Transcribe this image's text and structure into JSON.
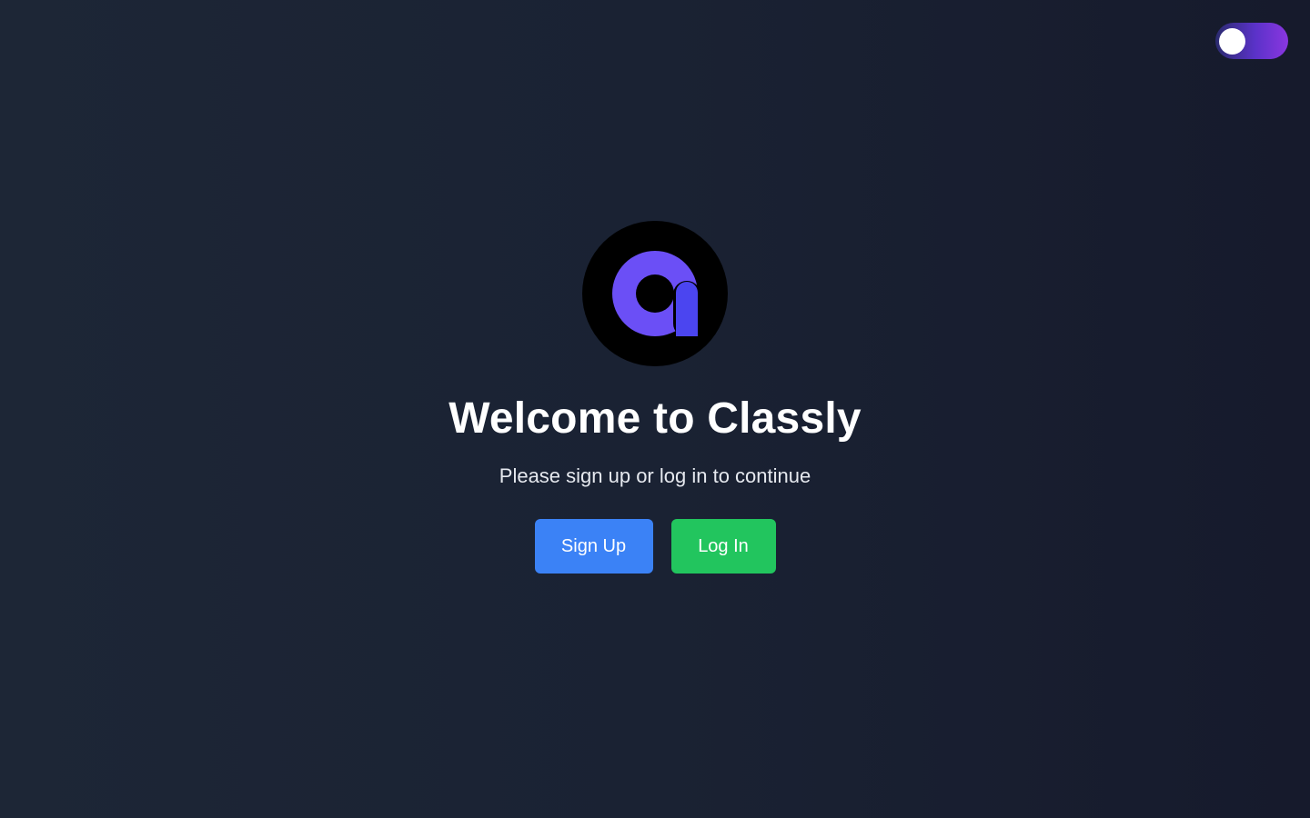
{
  "theme_toggle": {
    "state": "off"
  },
  "logo": {
    "icon": "classly-logo-icon",
    "colors": {
      "background": "#000000",
      "ring": "#6b4ff6",
      "bar": "#4b45f0"
    }
  },
  "welcome": {
    "title": "Welcome to Classly",
    "subtitle": "Please sign up or log in to continue"
  },
  "actions": {
    "signup_label": "Sign Up",
    "login_label": "Log In"
  },
  "colors": {
    "signup": "#3b82f6",
    "login": "#22c55e",
    "toggle_accent": "#8a36e0"
  }
}
